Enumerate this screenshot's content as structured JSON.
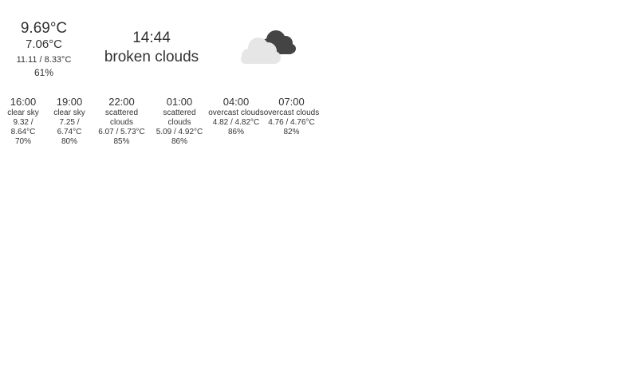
{
  "current": {
    "temperature": "9.69°C",
    "feels_like": "7.06°C",
    "range": "11.11 / 8.33°C",
    "humidity": "61%",
    "time": "14:44",
    "description": "broken clouds",
    "icon": "cloud-icon"
  },
  "colors": {
    "cloud_light": "#e6e6e6",
    "cloud_dark": "#444444"
  },
  "forecast": [
    {
      "time": "16:00",
      "description": "clear sky",
      "range": "9.32 / 8.64°C",
      "humidity": "70%"
    },
    {
      "time": "19:00",
      "description": "clear sky",
      "range": "7.25 / 6.74°C",
      "humidity": "80%"
    },
    {
      "time": "22:00",
      "description": "scattered clouds",
      "range": "6.07 / 5.73°C",
      "humidity": "85%"
    },
    {
      "time": "01:00",
      "description": "scattered clouds",
      "range": "5.09 / 4.92°C",
      "humidity": "86%"
    },
    {
      "time": "04:00",
      "description": "overcast clouds",
      "range": "4.82 / 4.82°C",
      "humidity": "86%"
    },
    {
      "time": "07:00",
      "description": "overcast clouds",
      "range": "4.76 / 4.76°C",
      "humidity": "82%"
    }
  ]
}
